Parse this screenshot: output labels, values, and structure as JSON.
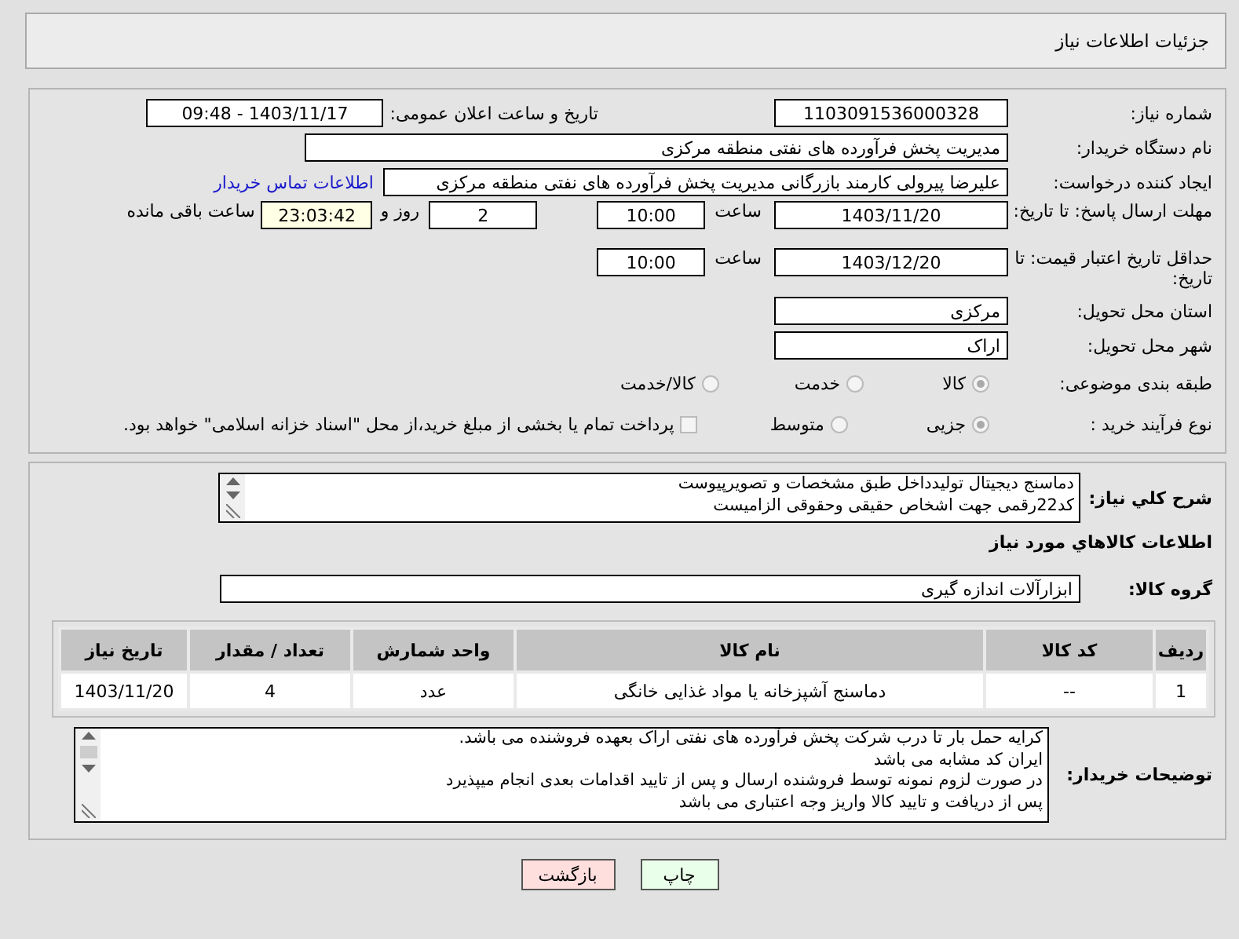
{
  "header": {
    "title": "جزئیات اطلاعات نیاز"
  },
  "details": {
    "need_number": {
      "label": "شماره نیاز:",
      "value": "1103091536000328"
    },
    "announce": {
      "label": "تاریخ و ساعت اعلان عمومی:",
      "value": "1403/11/17 - 09:48"
    },
    "buyer_org": {
      "label": "نام دستگاه خریدار:",
      "value": "مدیریت پخش فرآورده های نفتی منطقه مرکزی"
    },
    "requester": {
      "label": "ایجاد کننده درخواست:",
      "value": "علیرضا پیرولی کارمند بازرگانی مدیریت پخش فرآورده های نفتی منطقه مرکزی",
      "link": "اطلاعات تماس خریدار"
    },
    "reply_deadline": {
      "label": "مهلت ارسال پاسخ: تا تاریخ:",
      "date": "1403/11/20",
      "time_label": "ساعت",
      "time": "10:00",
      "days": "2",
      "days_label": "روز و",
      "remaining": "23:03:42",
      "remaining_label": "ساعت باقی مانده"
    },
    "price_validity": {
      "label": "حداقل تاریخ اعتبار قیمت: تا تاریخ:",
      "date": "1403/12/20",
      "time_label": "ساعت",
      "time": "10:00"
    },
    "province": {
      "label": "استان محل تحویل:",
      "value": "مرکزی"
    },
    "city": {
      "label": "شهر محل تحویل:",
      "value": "اراک"
    },
    "category": {
      "label": "طبقه بندی موضوعی:",
      "options": [
        {
          "label": "کالا",
          "selected": true
        },
        {
          "label": "خدمت",
          "selected": false
        },
        {
          "label": "کالا/خدمت",
          "selected": false
        }
      ]
    },
    "purchase_type": {
      "label": "نوع فرآیند خرید :",
      "options": [
        {
          "label": "جزیی",
          "selected": true
        },
        {
          "label": "متوسط",
          "selected": false
        }
      ],
      "checkbox": {
        "label": "پرداخت تمام یا بخشی از مبلغ خرید،از محل \"اسناد خزانه اسلامی\" خواهد بود.",
        "checked": false
      }
    }
  },
  "description": {
    "label": "شرح کلي نياز:",
    "lines": [
      "دماسنج دیجیتال تولیدداخل طبق مشخصات و تصویرپیوست",
      "کد22رقمی  جهت اشخاص حقیقی وحقوقی الزامیست"
    ]
  },
  "goods": {
    "title": "اطلاعات کالاهاي مورد نياز",
    "group_label": "گروه کالا:",
    "group_value": "ابزارآلات اندازه گیری",
    "table": {
      "columns": [
        "ردیف",
        "کد کالا",
        "نام کالا",
        "واحد شمارش",
        "تعداد / مقدار",
        "تاریخ نیاز"
      ],
      "rows": [
        [
          "1",
          "--",
          "دماسنج آشپزخانه یا مواد غذایی خانگی",
          "عدد",
          "4",
          "1403/11/20"
        ]
      ]
    }
  },
  "buyer_notes": {
    "label": "توضیحات خریدار:",
    "lines": [
      "کرایه حمل بار تا درب شرکت  پخش فرآورده های نفتی اراک بعهده فروشنده می باشد.",
      "ایران کد مشابه می باشد",
      "در صورت لزوم نمونه توسط فروشنده ارسال و پس از تایید اقدامات بعدی انجام میپذیرد",
      "پس از دریافت و تایید کالا واریز وجه اعتباری می باشد"
    ]
  },
  "buttons": [
    {
      "label": "چاپ",
      "kind": "print"
    },
    {
      "label": "بازگشت",
      "kind": "back"
    }
  ]
}
